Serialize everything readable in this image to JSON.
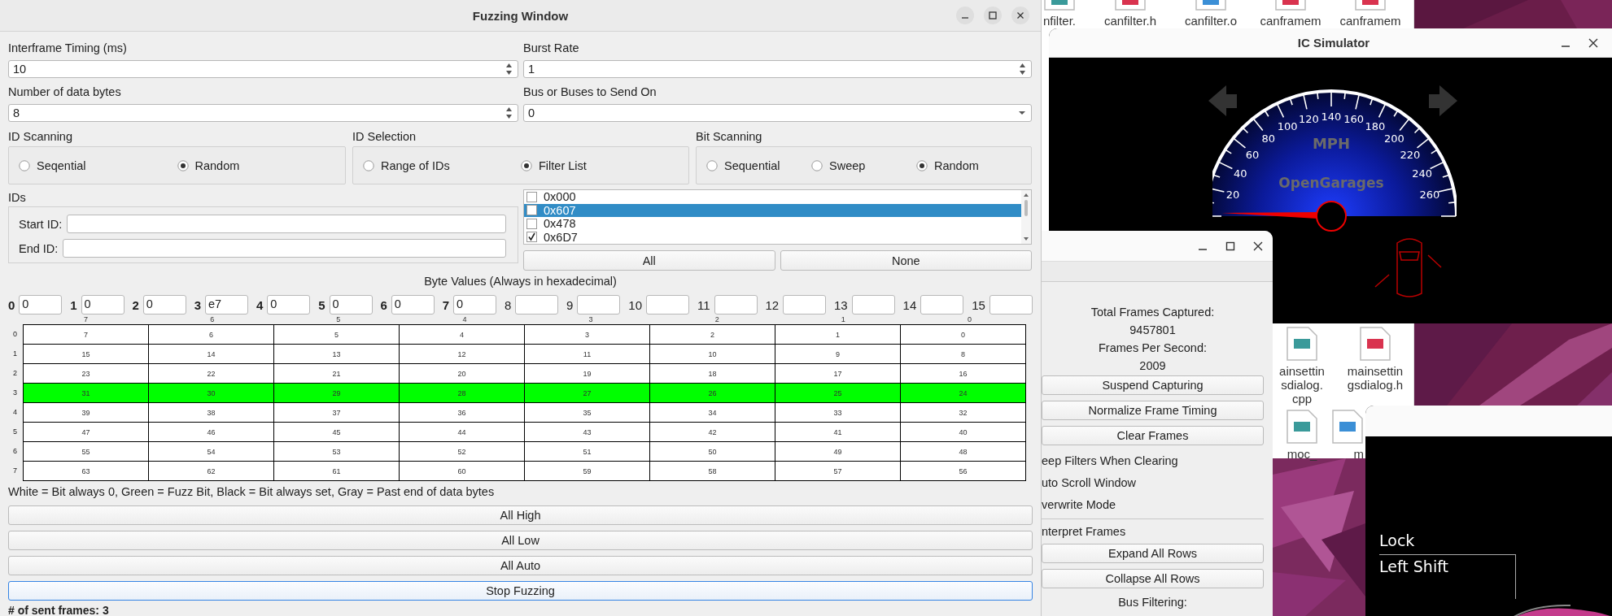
{
  "fuzzing_window": {
    "title": "Fuzzing Window",
    "fields": [
      {
        "label": "Interframe Timing (ms)",
        "value": "10",
        "kind": "spin"
      },
      {
        "label": "Burst Rate",
        "value": "1",
        "kind": "spin"
      },
      {
        "label": "Number of data bytes",
        "value": "8",
        "kind": "spin"
      },
      {
        "label": "Bus or Buses to Send On",
        "value": "0",
        "kind": "combo"
      }
    ],
    "groups": [
      {
        "title": "ID Scanning",
        "options": [
          {
            "label": "Seqential",
            "selected": false
          },
          {
            "label": "Random",
            "selected": true
          }
        ]
      },
      {
        "title": "ID Selection",
        "options": [
          {
            "label": "Range of IDs",
            "selected": false
          },
          {
            "label": "Filter List",
            "selected": true
          }
        ]
      },
      {
        "title": "Bit Scanning",
        "options": [
          {
            "label": "Sequential",
            "selected": false
          },
          {
            "label": "Sweep",
            "selected": false
          },
          {
            "label": "Random",
            "selected": true
          }
        ]
      }
    ],
    "ids": {
      "title": "IDs",
      "fields": [
        {
          "label": "Start ID:"
        },
        {
          "label": "End ID:"
        }
      ]
    },
    "id_list": {
      "items": [
        {
          "label": "0x000",
          "checked": false,
          "selected": false
        },
        {
          "label": "0x607",
          "checked": false,
          "selected": true
        },
        {
          "label": "0x478",
          "checked": false,
          "selected": false
        },
        {
          "label": "0x6D7",
          "checked": true,
          "selected": false
        }
      ],
      "buttons": [
        "All",
        "None"
      ]
    },
    "byte_values": {
      "title": "Byte Values (Always in hexadecimal)",
      "bytes": [
        {
          "index": "0",
          "value": "0",
          "in_range": true
        },
        {
          "index": "1",
          "value": "0",
          "in_range": true
        },
        {
          "index": "2",
          "value": "0",
          "in_range": true
        },
        {
          "index": "3",
          "value": "e7",
          "in_range": true
        },
        {
          "index": "4",
          "value": "0",
          "in_range": true
        },
        {
          "index": "5",
          "value": "0",
          "in_range": true
        },
        {
          "index": "6",
          "value": "0",
          "in_range": true
        },
        {
          "index": "7",
          "value": "0",
          "in_range": true
        },
        {
          "index": "8",
          "in_range": false
        },
        {
          "index": "9",
          "in_range": false
        },
        {
          "index": "10",
          "in_range": false
        },
        {
          "index": "11",
          "in_range": false
        },
        {
          "index": "12",
          "in_range": false
        },
        {
          "index": "13",
          "in_range": false
        },
        {
          "index": "14",
          "in_range": false
        },
        {
          "index": "15",
          "in_range": false
        }
      ]
    },
    "bit_grid": {
      "columns": [
        "7",
        "6",
        "5",
        "4",
        "3",
        "2",
        "1",
        "0"
      ],
      "rows": [
        {
          "label": "0",
          "cells": [
            {
              "text": "7",
              "color": "#ffffff"
            },
            {
              "text": "6",
              "color": "#ffffff"
            },
            {
              "text": "5",
              "color": "#ffffff"
            },
            {
              "text": "4",
              "color": "#ffffff"
            },
            {
              "text": "3",
              "color": "#ffffff"
            },
            {
              "text": "2",
              "color": "#ffffff"
            },
            {
              "text": "1",
              "color": "#ffffff"
            },
            {
              "text": "0",
              "color": "#ffffff"
            }
          ]
        },
        {
          "label": "1",
          "cells": [
            {
              "text": "15",
              "color": "#ffffff"
            },
            {
              "text": "14",
              "color": "#ffffff"
            },
            {
              "text": "13",
              "color": "#ffffff"
            },
            {
              "text": "12",
              "color": "#ffffff"
            },
            {
              "text": "11",
              "color": "#ffffff"
            },
            {
              "text": "10",
              "color": "#ffffff"
            },
            {
              "text": "9",
              "color": "#ffffff"
            },
            {
              "text": "8",
              "color": "#ffffff"
            }
          ]
        },
        {
          "label": "2",
          "cells": [
            {
              "text": "23",
              "color": "#ffffff"
            },
            {
              "text": "22",
              "color": "#ffffff"
            },
            {
              "text": "21",
              "color": "#ffffff"
            },
            {
              "text": "20",
              "color": "#ffffff"
            },
            {
              "text": "19",
              "color": "#ffffff"
            },
            {
              "text": "18",
              "color": "#ffffff"
            },
            {
              "text": "17",
              "color": "#ffffff"
            },
            {
              "text": "16",
              "color": "#ffffff"
            }
          ]
        },
        {
          "label": "3",
          "cells": [
            {
              "text": "31",
              "color": "#00ff00"
            },
            {
              "text": "30",
              "color": "#00ff00"
            },
            {
              "text": "29",
              "color": "#00ff00"
            },
            {
              "text": "28",
              "color": "#00ff00"
            },
            {
              "text": "27",
              "color": "#00ff00"
            },
            {
              "text": "26",
              "color": "#00ff00"
            },
            {
              "text": "25",
              "color": "#00ff00"
            },
            {
              "text": "24",
              "color": "#00ff00"
            }
          ]
        },
        {
          "label": "4",
          "cells": [
            {
              "text": "39",
              "color": "#ffffff"
            },
            {
              "text": "38",
              "color": "#ffffff"
            },
            {
              "text": "37",
              "color": "#ffffff"
            },
            {
              "text": "36",
              "color": "#ffffff"
            },
            {
              "text": "35",
              "color": "#ffffff"
            },
            {
              "text": "34",
              "color": "#ffffff"
            },
            {
              "text": "33",
              "color": "#ffffff"
            },
            {
              "text": "32",
              "color": "#ffffff"
            }
          ]
        },
        {
          "label": "5",
          "cells": [
            {
              "text": "47",
              "color": "#ffffff"
            },
            {
              "text": "46",
              "color": "#ffffff"
            },
            {
              "text": "45",
              "color": "#ffffff"
            },
            {
              "text": "44",
              "color": "#ffffff"
            },
            {
              "text": "43",
              "color": "#ffffff"
            },
            {
              "text": "42",
              "color": "#ffffff"
            },
            {
              "text": "41",
              "color": "#ffffff"
            },
            {
              "text": "40",
              "color": "#ffffff"
            }
          ]
        },
        {
          "label": "6",
          "cells": [
            {
              "text": "55",
              "color": "#ffffff"
            },
            {
              "text": "54",
              "color": "#ffffff"
            },
            {
              "text": "53",
              "color": "#ffffff"
            },
            {
              "text": "52",
              "color": "#ffffff"
            },
            {
              "text": "51",
              "color": "#ffffff"
            },
            {
              "text": "50",
              "color": "#ffffff"
            },
            {
              "text": "49",
              "color": "#ffffff"
            },
            {
              "text": "48",
              "color": "#ffffff"
            }
          ]
        },
        {
          "label": "7",
          "cells": [
            {
              "text": "63",
              "color": "#ffffff"
            },
            {
              "text": "62",
              "color": "#ffffff"
            },
            {
              "text": "61",
              "color": "#ffffff"
            },
            {
              "text": "60",
              "color": "#ffffff"
            },
            {
              "text": "59",
              "color": "#ffffff"
            },
            {
              "text": "58",
              "color": "#ffffff"
            },
            {
              "text": "57",
              "color": "#ffffff"
            },
            {
              "text": "56",
              "color": "#ffffff"
            }
          ]
        }
      ]
    },
    "legend": "White = Bit always 0, Green = Fuzz Bit, Black = Bit always set, Gray = Past end of data bytes",
    "buttons": [
      {
        "label": "All High",
        "focused": false
      },
      {
        "label": "All Low",
        "focused": false
      },
      {
        "label": "All Auto",
        "focused": false
      },
      {
        "label": "Stop Fuzzing",
        "focused": true
      }
    ],
    "sent_frames": "# of sent frames: 3"
  },
  "file_manager": {
    "top_row": [
      {
        "label": "nfilter.",
        "kind": "cpp"
      },
      {
        "label": "canfilter.h",
        "kind": "h"
      },
      {
        "label": "canfilter.o",
        "kind": "doc"
      },
      {
        "label": "canframem",
        "kind": "h"
      },
      {
        "label": "canframem",
        "kind": "h"
      }
    ],
    "lower_items": [
      {
        "lines": [
          "ainsettin",
          "sdialog.",
          "cpp"
        ],
        "kind": "cpp"
      },
      {
        "lines": [
          "mainsettin",
          "gsdialog.h"
        ],
        "kind": "h"
      },
      {
        "lines": [
          "moc_"
        ],
        "kind": "cpp"
      },
      {
        "lines": [
          "m"
        ],
        "kind": "doc"
      }
    ]
  },
  "ic_simulator": {
    "title": "IC Simulator",
    "speed_labels": [
      "20",
      "40",
      "60",
      "80",
      "100",
      "120",
      "140",
      "160",
      "180",
      "200",
      "220",
      "240",
      "260"
    ],
    "unit": "MPH",
    "brand": "OpenGarages"
  },
  "main_dialog": {
    "items": [
      {
        "kind": "stat",
        "text": "Total Frames Captured:"
      },
      {
        "kind": "stat",
        "text": "9457801"
      },
      {
        "kind": "stat",
        "text": "Frames Per Second:"
      },
      {
        "kind": "stat",
        "text": "2009"
      },
      {
        "kind": "button",
        "text": "Suspend Capturing"
      },
      {
        "kind": "button",
        "text": "Normalize Frame Timing"
      },
      {
        "kind": "button",
        "text": "Clear Frames"
      },
      {
        "kind": "option",
        "text": "eep Filters When Clearing"
      },
      {
        "kind": "option",
        "text": "uto Scroll Window"
      },
      {
        "kind": "option",
        "text": "verwrite Mode"
      },
      {
        "kind": "separator"
      },
      {
        "kind": "option",
        "text": "nterpret Frames"
      },
      {
        "kind": "button",
        "text": "Expand All Rows"
      },
      {
        "kind": "button",
        "text": "Collapse All Rows"
      },
      {
        "kind": "stat",
        "text": "Bus Filtering:"
      }
    ]
  },
  "key_window": {
    "lines": [
      "Lock",
      "Left Shift"
    ]
  }
}
